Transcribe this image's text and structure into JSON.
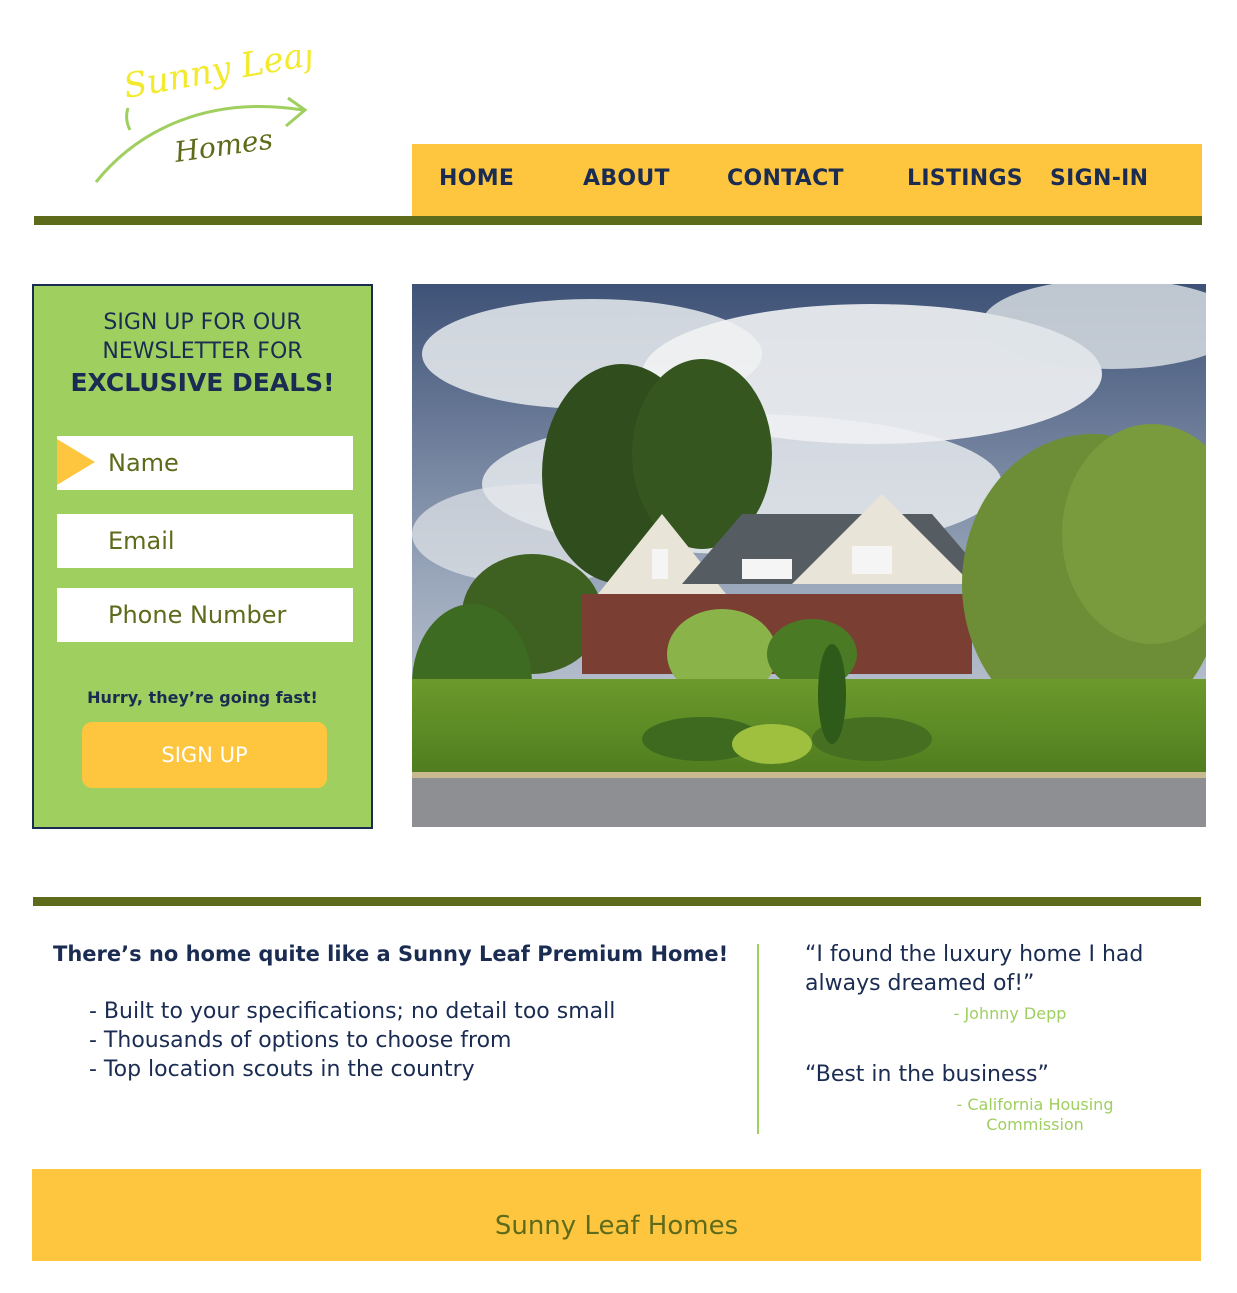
{
  "logo": {
    "line1": "Sunny Leaf",
    "line2": "Homes"
  },
  "nav": {
    "items": [
      "HOME",
      "ABOUT",
      "CONTACT",
      "LISTINGS",
      "SIGN-IN"
    ]
  },
  "newsletter": {
    "line1": "SIGN UP FOR OUR",
    "line2": "NEWSLETTER FOR",
    "line3": "EXCLUSIVE DEALS!",
    "fields": {
      "name_placeholder": "Name",
      "email_placeholder": "Email",
      "phone_placeholder": "Phone Number"
    },
    "urgency": "Hurry, they’re going fast!",
    "button": "SIGN UP"
  },
  "features": {
    "title": "There’s no home quite like a Sunny Leaf Premium Home!",
    "items": [
      "- Built to your specifications; no detail too small",
      "- Thousands of options to choose from",
      "- Top location scouts in the country"
    ]
  },
  "testimonials": [
    {
      "quote": "“I found the luxury home I had always dreamed of!”",
      "author": "- Johnny Depp"
    },
    {
      "quote": "“Best in the business”",
      "author": "- California Housing Commission"
    }
  ],
  "footer": {
    "text": "Sunny Leaf Homes"
  },
  "colors": {
    "yellow": "#fec63f",
    "olive": "#5e6b1b",
    "green": "#9fcf5f",
    "navy": "#1b2c52"
  }
}
